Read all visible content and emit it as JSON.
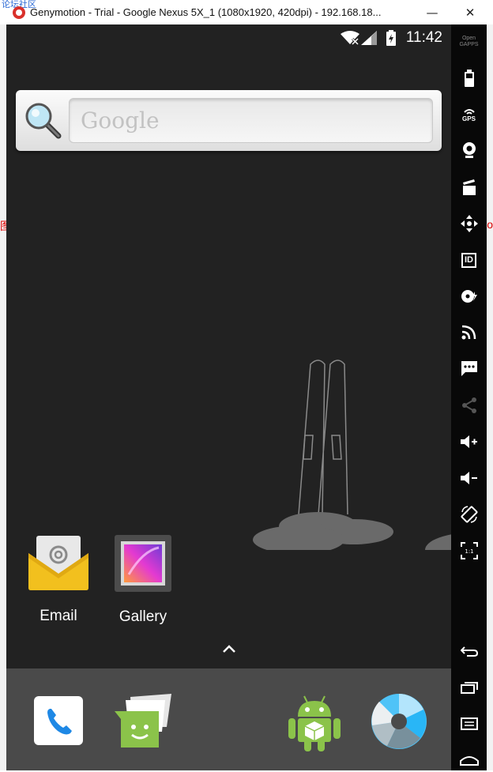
{
  "window": {
    "title": "Genymotion - Trial - Google Nexus 5X_1 (1080x1920, 420dpi) - 192.168.18...",
    "overlay_text": "论坛社区",
    "edge_char_left": "图",
    "edge_char_right": "o",
    "buttons": {
      "minimize": "—",
      "maximize": "☐",
      "close": "✕"
    }
  },
  "statusbar": {
    "time": "11:42"
  },
  "search_widget": {
    "placeholder": "Google"
  },
  "apps": [
    {
      "label": "Email",
      "icon": "email-icon"
    },
    {
      "label": "Gallery",
      "icon": "gallery-icon"
    }
  ],
  "dock": [
    {
      "icon": "phone-icon"
    },
    {
      "icon": "messenger-icon"
    },
    {
      "icon": "android-app-icon"
    },
    {
      "icon": "camera-icon"
    }
  ],
  "toolbar": {
    "open_gapps_label": "Open GAPPS",
    "gps_label": "GPS",
    "id_label": "ID",
    "tools": [
      "battery-icon",
      "gps-icon",
      "webcam-icon",
      "capture-icon",
      "dpad-icon",
      "id-icon",
      "disk-icon",
      "rss-icon",
      "sms-icon",
      "share-icon",
      "volume-up-icon",
      "volume-down-icon",
      "rotate-icon",
      "pixel-perfect-icon",
      "back-icon",
      "recent-apps-icon",
      "menu-icon",
      "home-icon"
    ]
  }
}
